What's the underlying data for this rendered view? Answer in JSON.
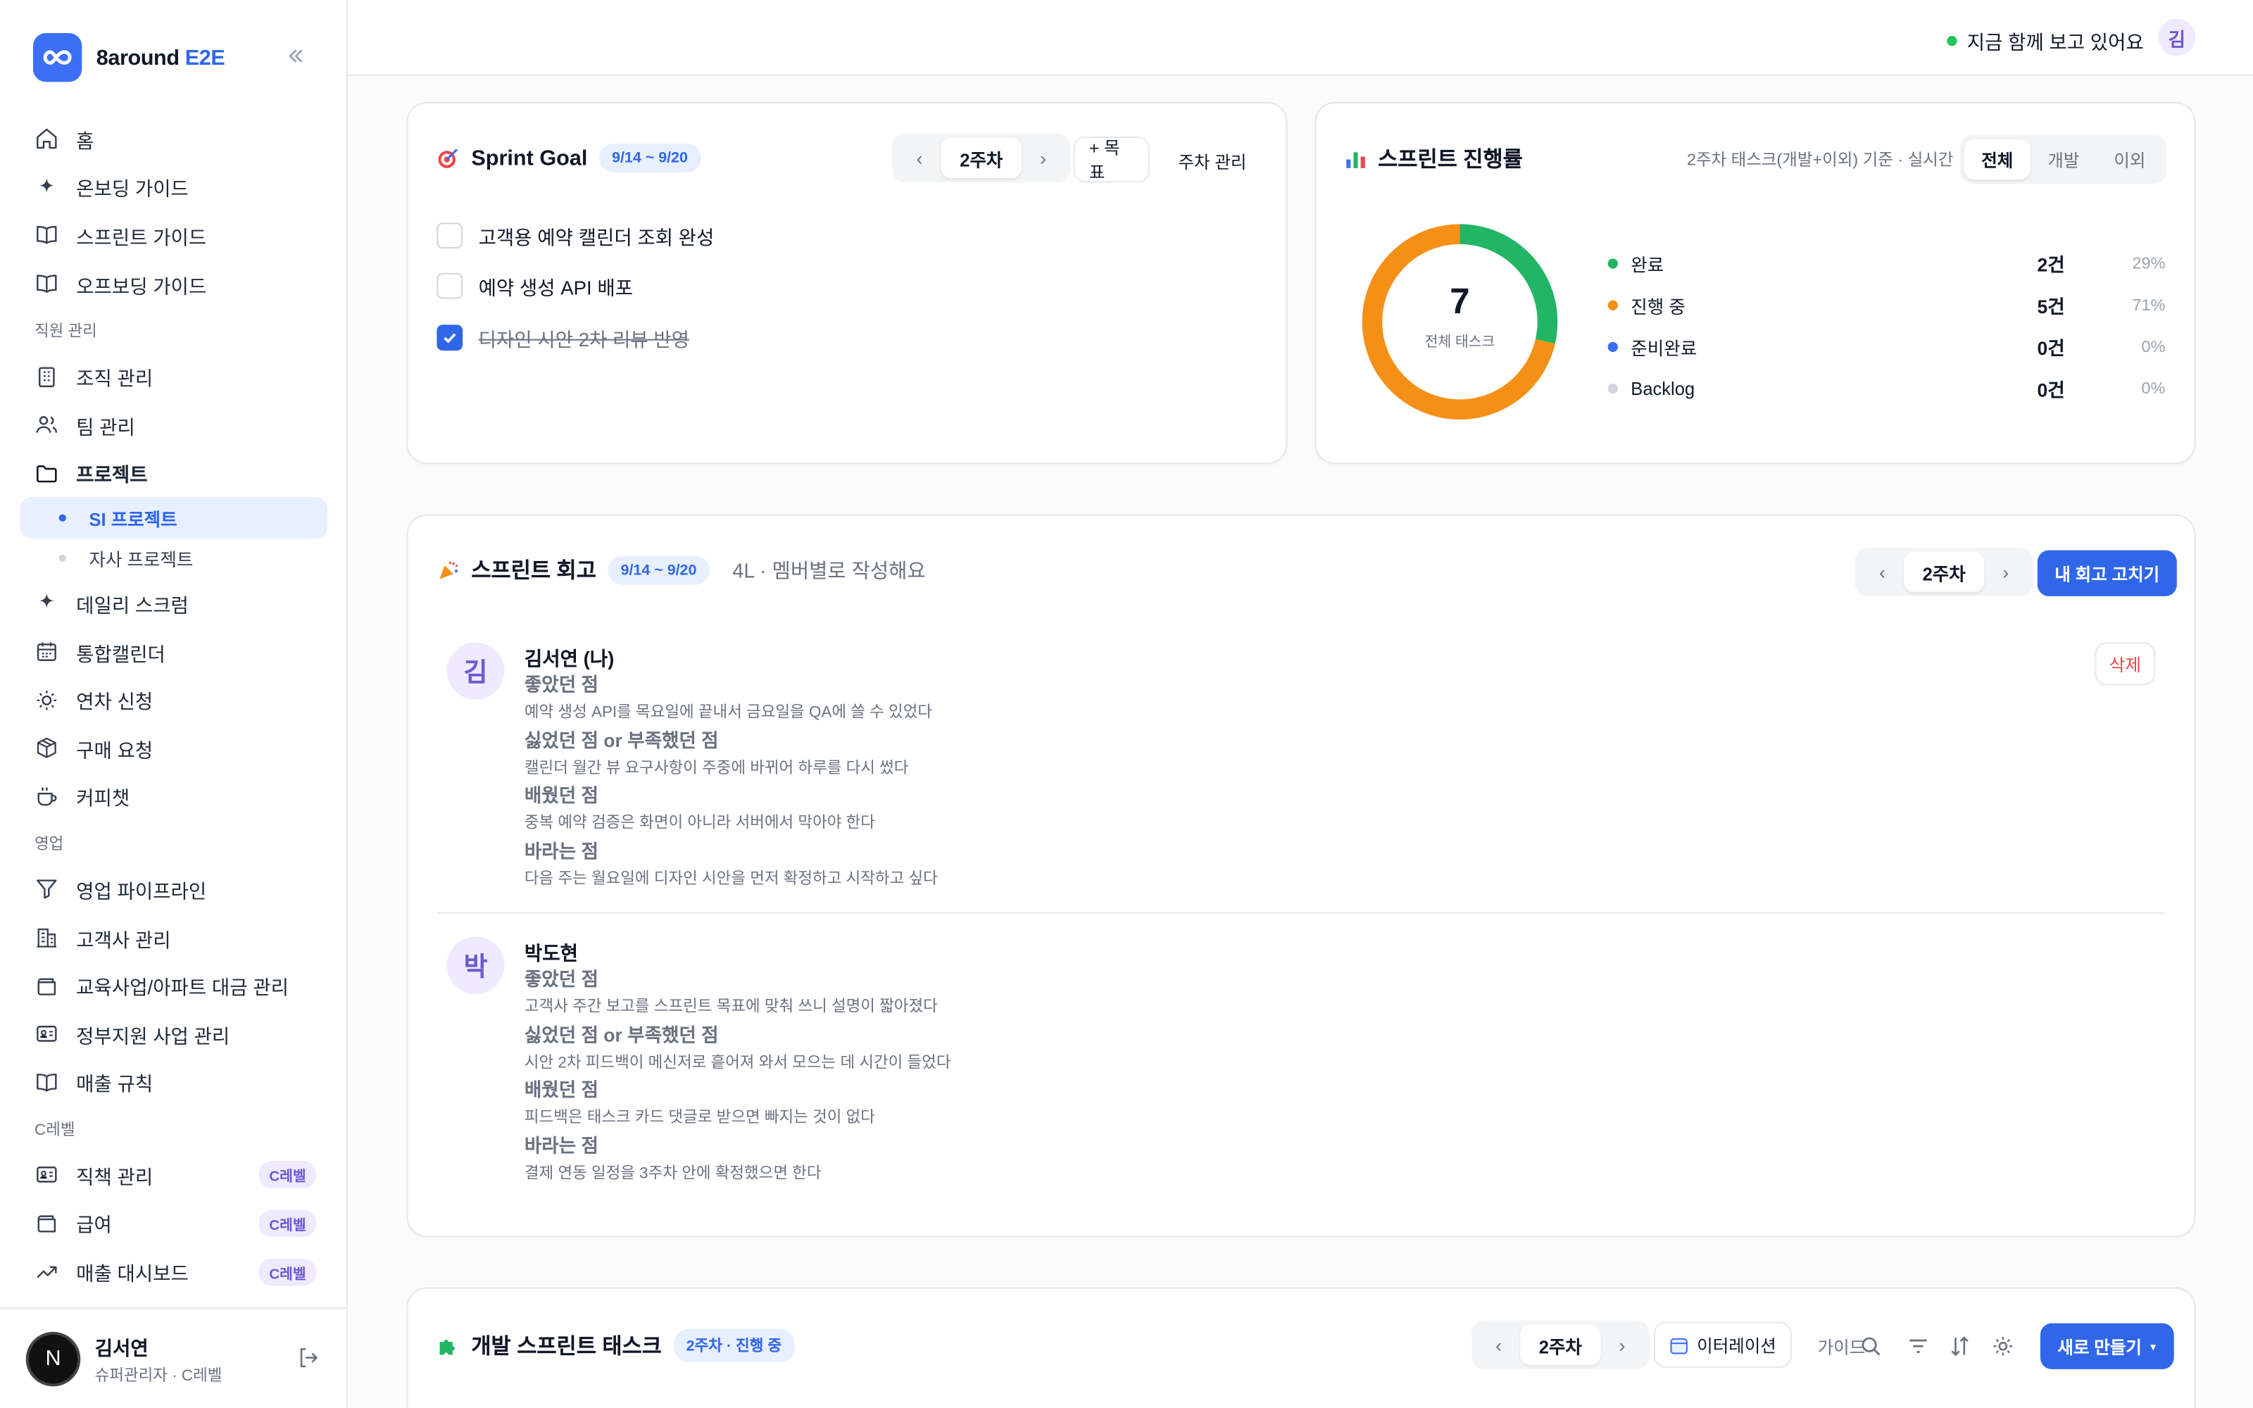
{
  "brand": {
    "name_prefix": "8around",
    "name_accent": "E2E"
  },
  "sidebar": {
    "items_top": [
      {
        "label": "홈",
        "icon": "home-icon"
      },
      {
        "label": "온보딩 가이드",
        "icon": "sparkle-icon"
      },
      {
        "label": "스프린트 가이드",
        "icon": "book-icon"
      },
      {
        "label": "오프보딩 가이드",
        "icon": "book-icon"
      }
    ],
    "section_staff": "직원 관리",
    "items_staff": [
      {
        "label": "조직 관리",
        "icon": "building-icon"
      },
      {
        "label": "팀 관리",
        "icon": "users-icon"
      },
      {
        "label": "프로젝트",
        "icon": "folder-icon"
      }
    ],
    "sub_projects": [
      "SI 프로젝트",
      "자사 프로젝트"
    ],
    "items_mid": [
      {
        "label": "데일리 스크럼",
        "icon": "sparkle-icon"
      },
      {
        "label": "통합캘린더",
        "icon": "calendar-icon"
      },
      {
        "label": "연차 신청",
        "icon": "sun-icon"
      },
      {
        "label": "구매 요청",
        "icon": "box-icon"
      },
      {
        "label": "커피챗",
        "icon": "coffee-icon"
      }
    ],
    "section_sales": "영업",
    "items_sales": [
      {
        "label": "영업 파이프라인",
        "icon": "filter-icon"
      },
      {
        "label": "고객사 관리",
        "icon": "office-icon"
      },
      {
        "label": "교육사업/아파트 대금 관리",
        "icon": "wallet-icon"
      },
      {
        "label": "정부지원 사업 관리",
        "icon": "id-card-icon"
      },
      {
        "label": "매출 규칙",
        "icon": "book-icon"
      }
    ],
    "section_c": "C레벨",
    "items_c": [
      {
        "label": "직책 관리",
        "icon": "id-card-icon",
        "badge": "C레벨"
      },
      {
        "label": "급여",
        "icon": "wallet-icon",
        "badge": "C레벨"
      },
      {
        "label": "매출 대시보드",
        "icon": "trend-icon",
        "badge": "C레벨"
      }
    ],
    "user": {
      "initial": "N",
      "name": "김서연",
      "role": "슈퍼관리자 · C레벨"
    }
  },
  "topbar": {
    "presence": "지금 함께 보고 있어요",
    "avatar": "김"
  },
  "sprint_goal": {
    "title": "Sprint Goal",
    "dates": "9/14 ~ 9/20",
    "week": "2주차",
    "prev": "‹",
    "next": "›",
    "add_goal": "+ 목표",
    "manage": "주차 관리",
    "goals": [
      {
        "text": "고객용 예약 캘린더 조회 완성",
        "done": false
      },
      {
        "text": "예약 생성 API 배포",
        "done": false
      },
      {
        "text": "디자인 시안 2차 리뷰 반영",
        "done": true
      }
    ]
  },
  "progress": {
    "title": "스프린트 진행률",
    "basis": "2주차 태스크(개발+이외) 기준 · 실시간",
    "tabs": [
      "전체",
      "개발",
      "이외"
    ],
    "total": "7",
    "total_label": "전체 태스크",
    "legend": [
      {
        "label": "완료",
        "count": "2건",
        "pct": "29%",
        "color": "#22b565",
        "value": 2
      },
      {
        "label": "진행 중",
        "count": "5건",
        "pct": "71%",
        "color": "#f59016",
        "value": 5
      },
      {
        "label": "준비완료",
        "count": "0건",
        "pct": "0%",
        "color": "#3b6ff5",
        "value": 0
      },
      {
        "label": "Backlog",
        "count": "0건",
        "pct": "0%",
        "color": "#d1d5db",
        "value": 0
      }
    ]
  },
  "retro": {
    "title": "스프린트 회고",
    "dates": "9/14 ~ 9/20",
    "subtitle": "4L · 멤버별로 작성해요",
    "week": "2주차",
    "edit_button": "내 회고 고치기",
    "delete_button": "삭제",
    "members": [
      {
        "initial": "김",
        "name": "김서연 (나)",
        "sections": [
          {
            "h": "좋았던 점",
            "t": "예약 생성 API를 목요일에 끝내서 금요일을 QA에 쓸 수 있었다"
          },
          {
            "h": "싫었던 점 or 부족했던 점",
            "t": "캘린더 월간 뷰 요구사항이 주중에 바뀌어 하루를 다시 썼다"
          },
          {
            "h": "배웠던 점",
            "t": "중복 예약 검증은 화면이 아니라 서버에서 막아야 한다"
          },
          {
            "h": "바라는 점",
            "t": "다음 주는 월요일에 디자인 시안을 먼저 확정하고 시작하고 싶다"
          }
        ]
      },
      {
        "initial": "박",
        "name": "박도현",
        "sections": [
          {
            "h": "좋았던 점",
            "t": "고객사 주간 보고를 스프린트 목표에 맞춰 쓰니 설명이 짧아졌다"
          },
          {
            "h": "싫었던 점 or 부족했던 점",
            "t": "시안 2차 피드백이 메신저로 흩어져 와서 모으는 데 시간이 들었다"
          },
          {
            "h": "배웠던 점",
            "t": "피드백은 태스크 카드 댓글로 받으면 빠지는 것이 없다"
          },
          {
            "h": "바라는 점",
            "t": "결제 연동 일정을 3주차 안에 확정했으면 한다"
          }
        ]
      }
    ]
  },
  "dev_tasks": {
    "title": "개발 스프린트 태스크",
    "status": "2주차 · 진행 중",
    "week": "2주차",
    "iteration": "이터레이션",
    "guide": "가이드",
    "new_button": "새로 만들기"
  }
}
